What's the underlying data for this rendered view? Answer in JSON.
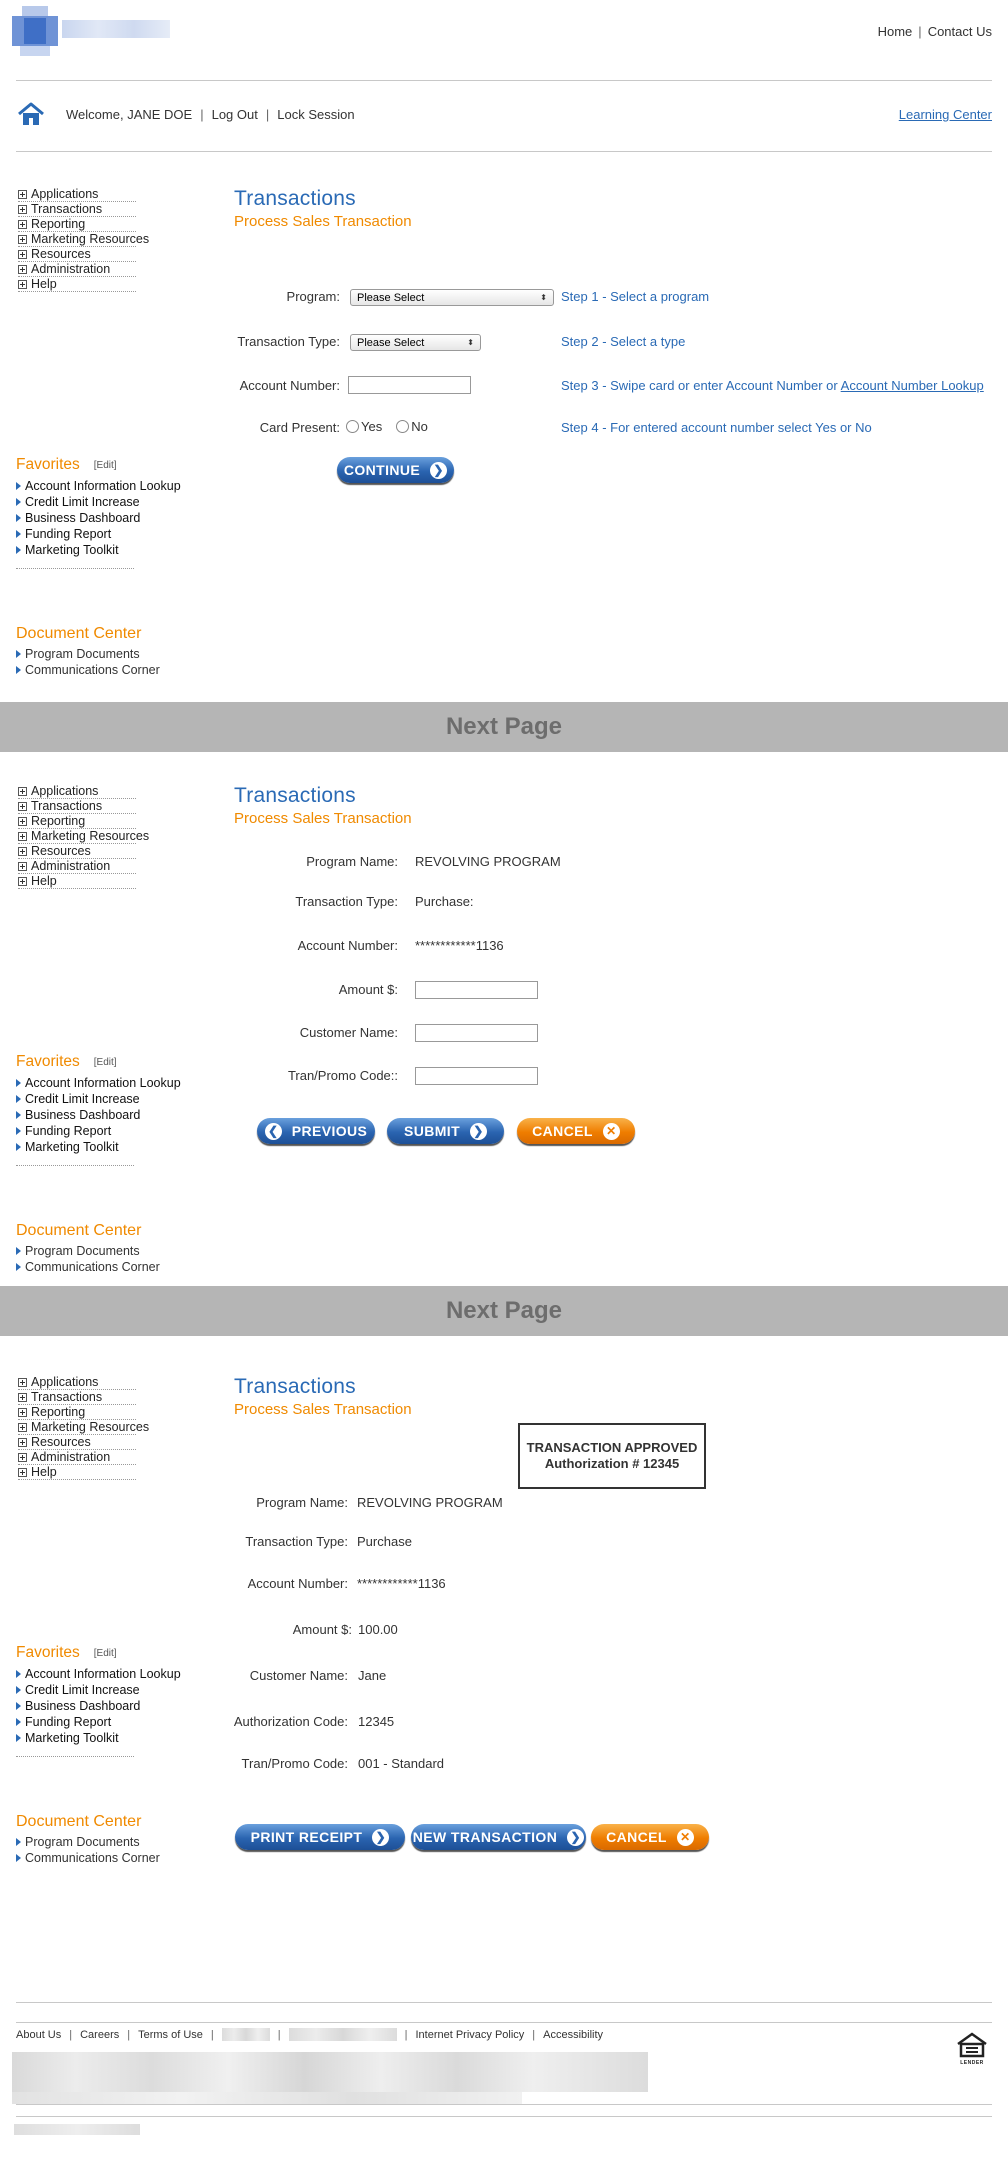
{
  "header": {
    "home_link": "Home",
    "separator": "|",
    "contact_link": "Contact Us",
    "welcome_prefix": "Welcome,",
    "user_name": "JANE DOE",
    "logout_link": "Log Out",
    "lock_link": "Lock Session",
    "learning_center_link": "Learning Center"
  },
  "sidebar": {
    "nav": [
      "Applications",
      "Transactions",
      "Reporting",
      "Marketing Resources",
      "Resources",
      "Administration",
      "Help"
    ],
    "favorites_title": "Favorites",
    "favorites_edit": "[Edit]",
    "favorites": [
      "Account Information Lookup",
      "Credit Limit Increase",
      "Business Dashboard",
      "Funding Report",
      "Marketing Toolkit"
    ],
    "doc_center_title": "Document Center",
    "doc_center": [
      "Program Documents",
      "Communications Corner"
    ]
  },
  "page": {
    "title": "Transactions",
    "subtitle": "Process Sales Transaction"
  },
  "divider_label": "Next Page",
  "screen1": {
    "program_label": "Program:",
    "program_value": "Please Select",
    "type_label": "Transaction Type:",
    "type_value": "Please Select",
    "account_label": "Account Number:",
    "account_value": "",
    "card_label": "Card Present:",
    "yes": "Yes",
    "no": "No",
    "step1": "Step 1 - Select a program",
    "step2": "Step 2 - Select a type",
    "step3_prefix": "Step 3 - Swipe card or enter Account Number or",
    "step3_link": "Account Number Lookup",
    "step4": "Step 4 - For entered account number select Yes or No",
    "continue_label": "CONTINUE"
  },
  "screen2": {
    "program_label": "Program Name:",
    "program_value": "REVOLVING PROGRAM",
    "type_label": "Transaction Type:",
    "type_value": "Purchase:",
    "account_label": "Account Number:",
    "account_value": "************1136",
    "amount_label": "Amount $:",
    "amount_value": "",
    "customer_label": "Customer Name:",
    "customer_value": "",
    "promo_label": "Tran/Promo Code::",
    "promo_value": "",
    "previous_label": "PREVIOUS",
    "submit_label": "SUBMIT",
    "cancel_label": "CANCEL"
  },
  "screen3": {
    "approved_line1": "TRANSACTION APPROVED",
    "approved_line2": "Authorization # 12345",
    "program_label": "Program Name:",
    "program_value": "REVOLVING PROGRAM",
    "type_label": "Transaction Type:",
    "type_value": "Purchase",
    "account_label": "Account Number:",
    "account_value": "************1136",
    "amount_label": "Amount $:",
    "amount_value": "100.00",
    "customer_label": "Customer Name:",
    "customer_value": "Jane",
    "auth_label": "Authorization Code:",
    "auth_value": "12345",
    "promo_label": "Tran/Promo Code:",
    "promo_value": "001 - Standard",
    "print_label": "PRINT RECEIPT",
    "new_label": "NEW TRANSACTION",
    "cancel_label": "CANCEL"
  },
  "footer": {
    "links": [
      "About Us",
      "Careers",
      "Terms of Use",
      "Internet Privacy Policy",
      "Accessibility"
    ],
    "equal_housing": "LENDER"
  },
  "colors": {
    "brand_blue": "#2a6ab5",
    "accent_orange": "#f08a00",
    "divider_gray": "#b5b5b5"
  }
}
